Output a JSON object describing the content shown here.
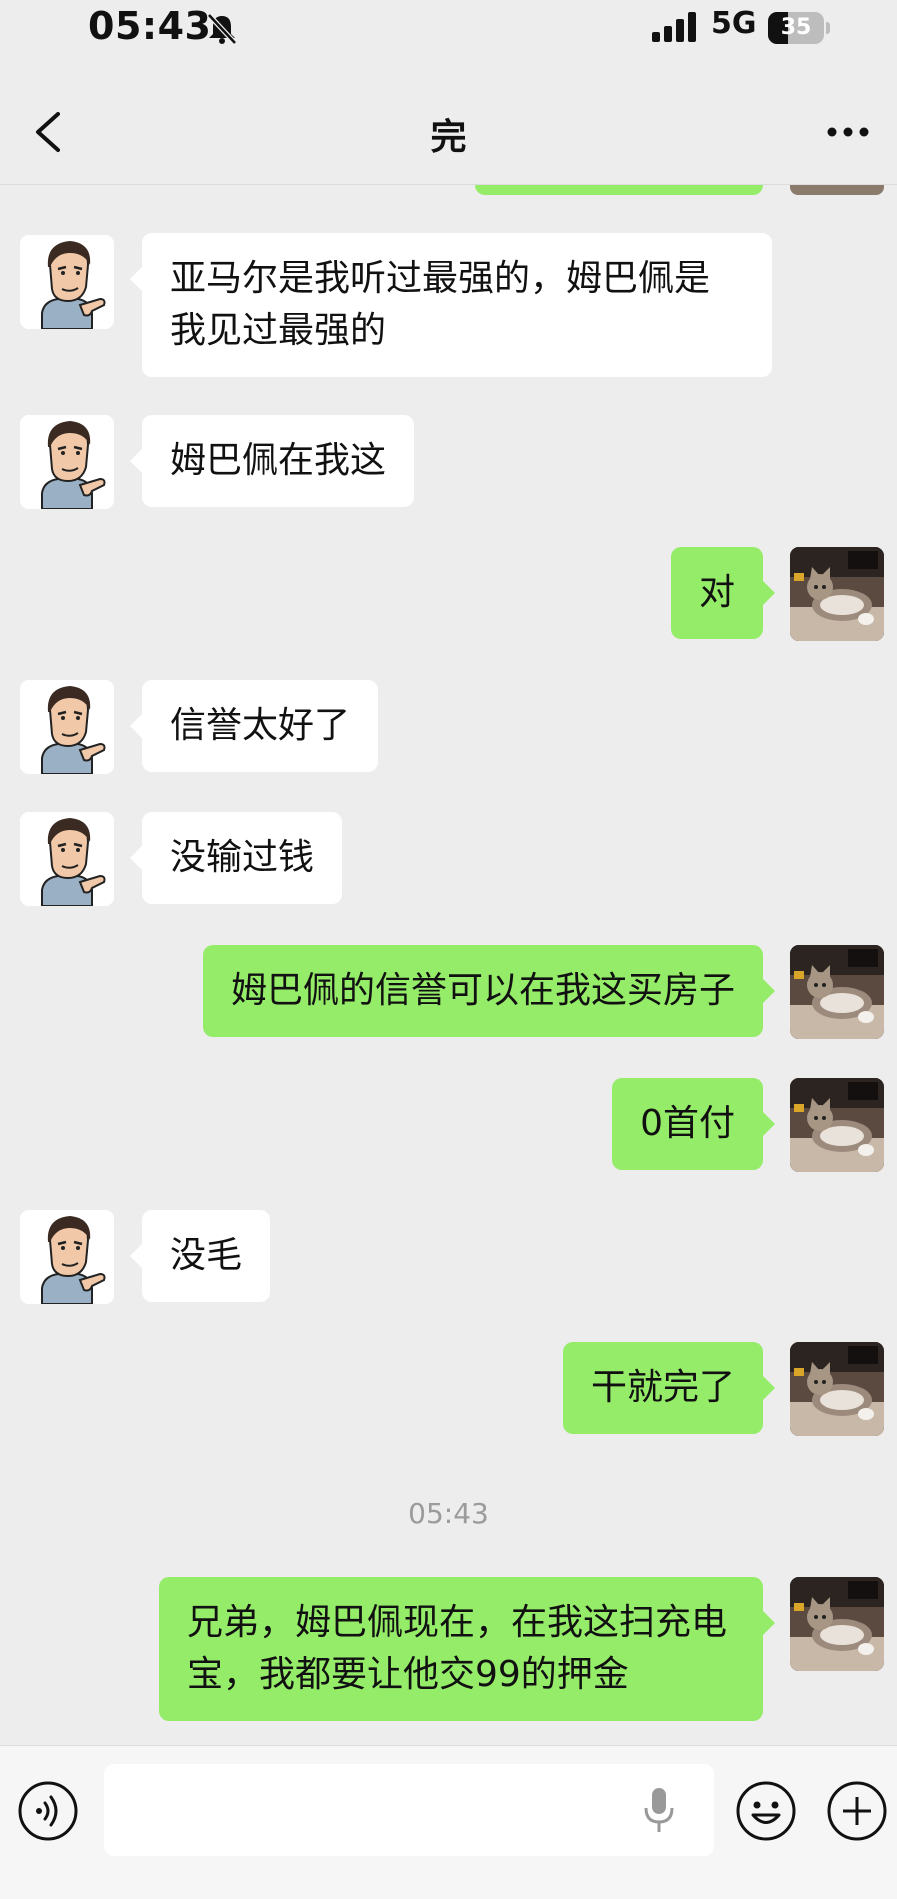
{
  "status_bar": {
    "time": "05:43",
    "network": "5G",
    "battery_percent": "35",
    "icons": [
      "bell-muted-icon",
      "signal-bars-icon",
      "battery-icon"
    ]
  },
  "nav": {
    "title": "完",
    "back_icon": "chevron-left-icon",
    "more_icon": "more-dots-icon"
  },
  "messages": [
    {
      "side": "left",
      "text": "亚马尔是我听过最强的，姆巴佩是我见过最强的"
    },
    {
      "side": "left",
      "text": "姆巴佩在我这"
    },
    {
      "side": "right",
      "text": "对"
    },
    {
      "side": "left",
      "text": "信誉太好了"
    },
    {
      "side": "left",
      "text": "没输过钱"
    },
    {
      "side": "right",
      "text": "姆巴佩的信誉可以在我这买房子"
    },
    {
      "side": "right",
      "text": "0首付"
    },
    {
      "side": "left",
      "text": "没毛"
    },
    {
      "side": "right",
      "text": "干就完了"
    },
    {
      "type": "timestamp",
      "text": "05:43"
    },
    {
      "side": "right",
      "text": "兄弟，姆巴佩现在，在我这扫充电宝，我都要让他交99的押金"
    }
  ],
  "input_bar": {
    "placeholder": "",
    "icons": [
      "voice-icon",
      "microphone-icon",
      "emoji-icon",
      "plus-icon"
    ]
  },
  "colors": {
    "background": "#ededed",
    "bubble_sent": "#95ec69",
    "bubble_received": "#ffffff",
    "timestamp": "#9b9b9b"
  }
}
